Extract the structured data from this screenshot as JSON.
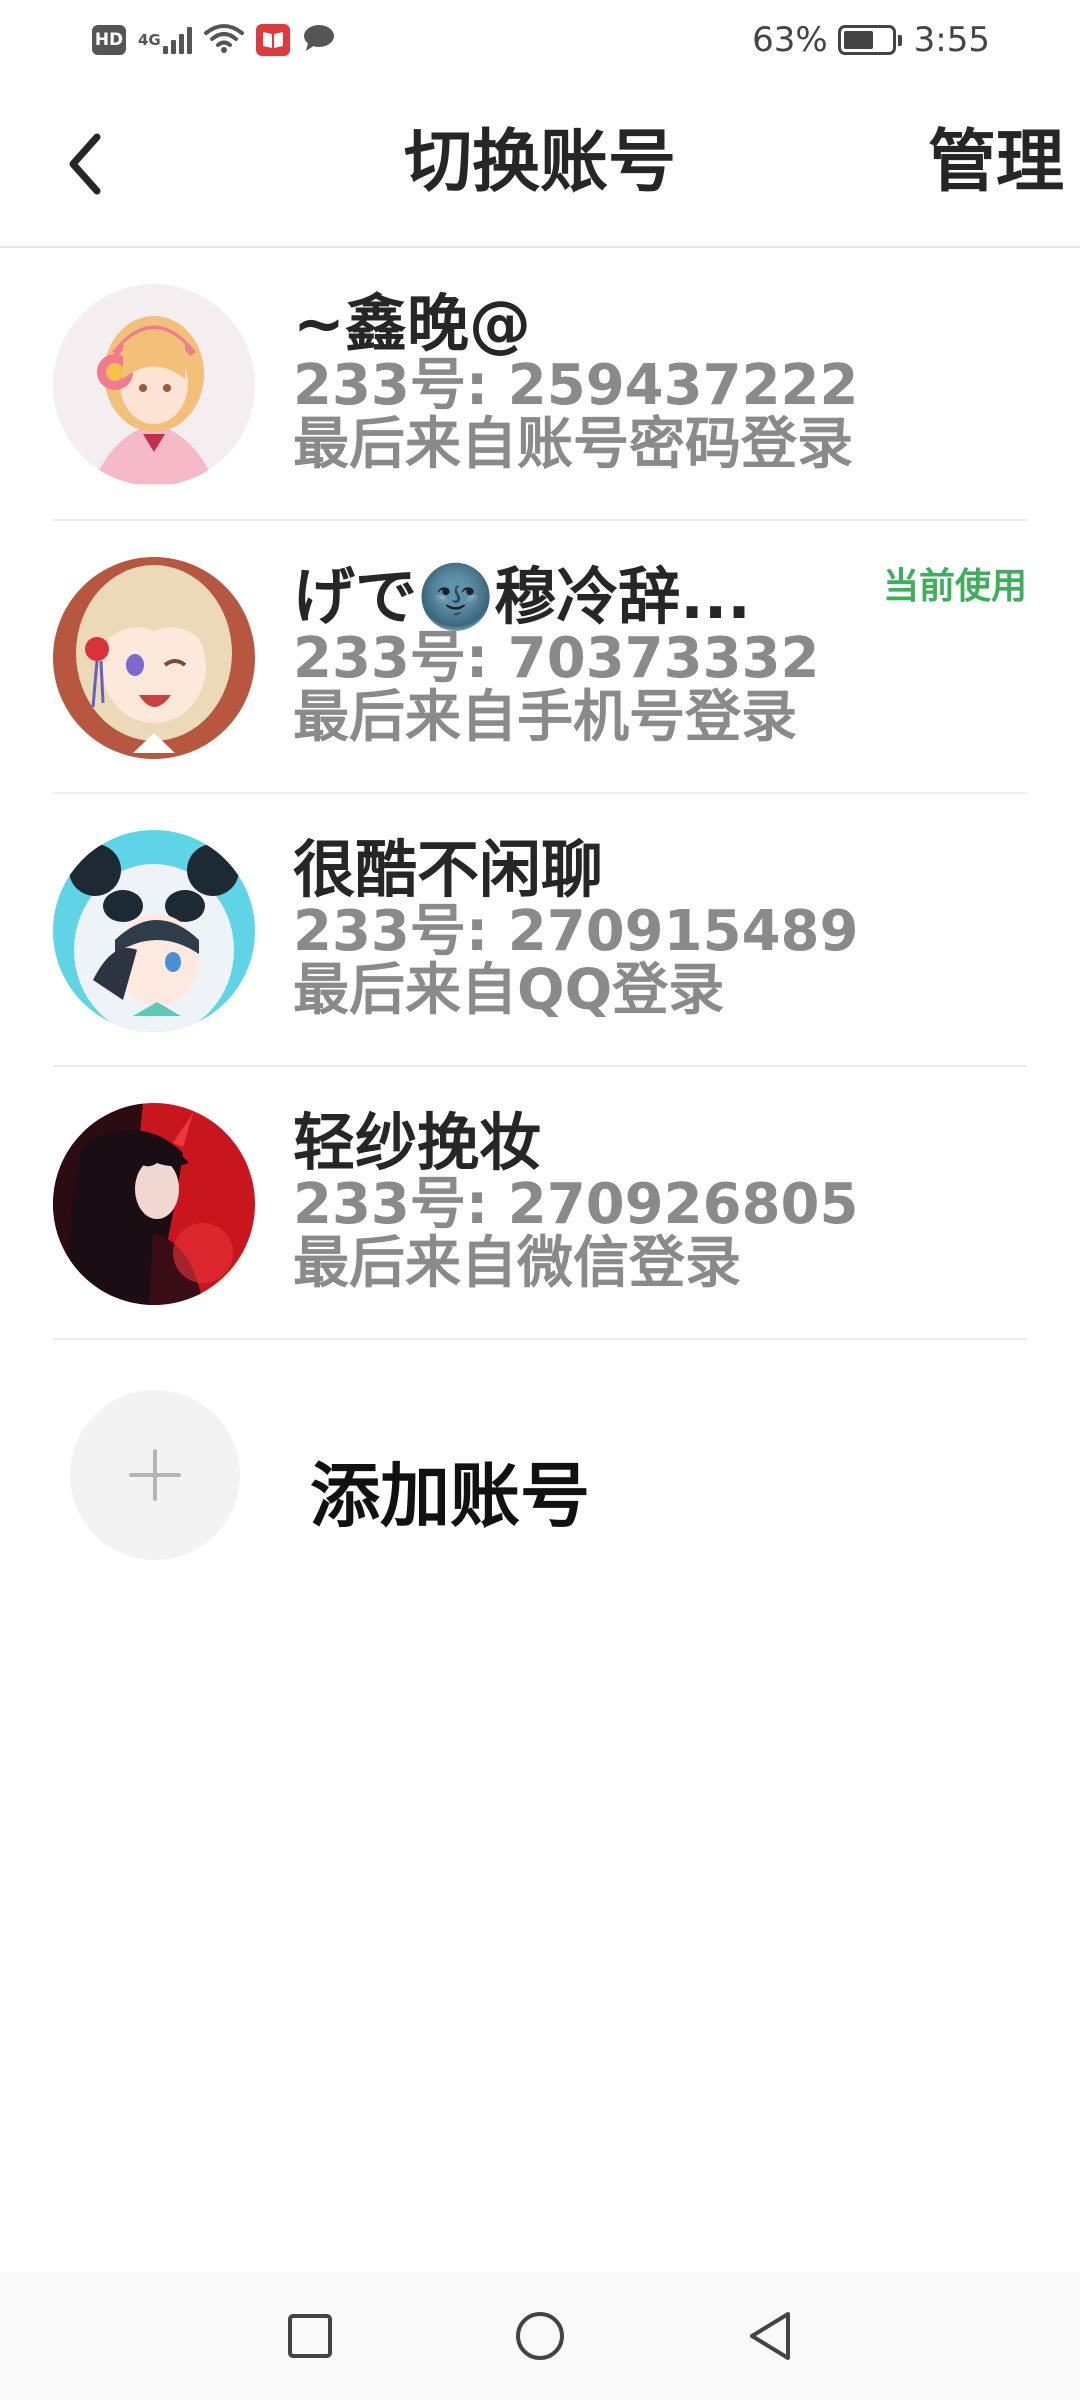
{
  "status_bar": {
    "hd_label": "HD",
    "network_label": "4G",
    "battery_percent": "63%",
    "battery_level": 0.63,
    "time": "3:55",
    "icons": [
      "hd-icon",
      "signal-icon",
      "wifi-icon",
      "book-app-icon",
      "chat-notification-icon",
      "battery-icon"
    ]
  },
  "header": {
    "title": "切换账号",
    "manage_label": "管理",
    "back_icon": "chevron-left-icon"
  },
  "accounts": [
    {
      "name": "~鑫晚@",
      "id_text": "233号: 259437222",
      "source": "最后来自账号密码登录",
      "current": ""
    },
    {
      "name": "げで🌚穆冷辞...",
      "id_text": "233号: 70373332",
      "source": "最后来自手机号登录",
      "current": "当前使用"
    },
    {
      "name": "很酷不闲聊",
      "id_text": "233号: 270915489",
      "source": "最后来自QQ登录",
      "current": ""
    },
    {
      "name": "轻纱挽妆",
      "id_text": "233号: 270926805",
      "source": "最后来自微信登录",
      "current": ""
    }
  ],
  "add_account": {
    "label": "添加账号",
    "icon": "plus-icon"
  },
  "nav_bar": {
    "icons": [
      "recent-apps-icon",
      "home-icon",
      "back-icon"
    ]
  },
  "colors": {
    "current_badge": "#3cae5c",
    "secondary_text": "#8a8a8a",
    "primary_text": "#262626"
  }
}
